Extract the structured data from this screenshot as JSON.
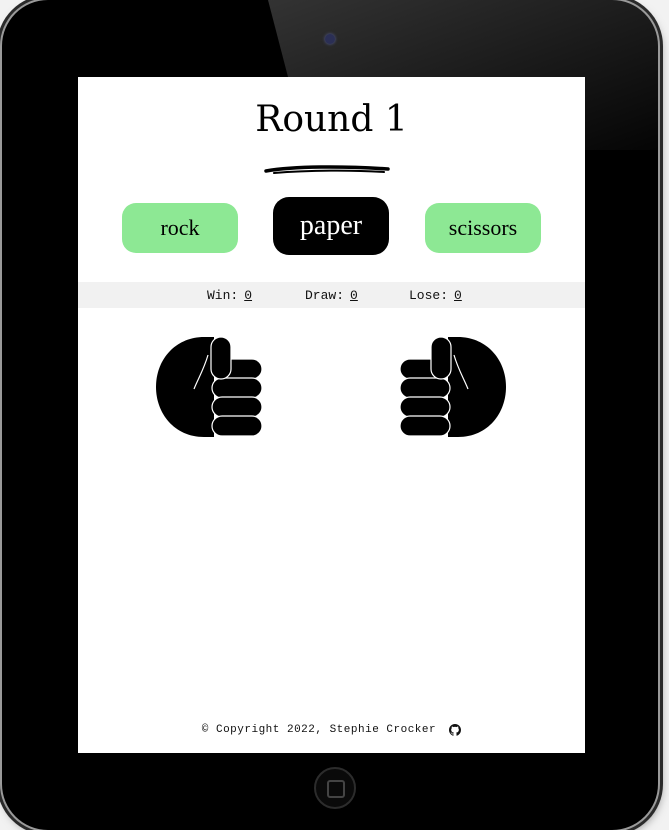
{
  "game": {
    "round_title": "Round 1"
  },
  "choices": {
    "rock": "rock",
    "paper": "paper",
    "scissors": "scissors"
  },
  "score": {
    "win_label": "Win:",
    "win_value": "0",
    "draw_label": "Draw:",
    "draw_value": "0",
    "lose_label": "Lose:",
    "lose_value": "0"
  },
  "hands": {
    "player": "rock-hand-icon",
    "computer": "rock-hand-icon"
  },
  "footer": {
    "copyright": "© Copyright 2022, Stephie Crocker",
    "github_icon": "github-icon"
  },
  "colors": {
    "button_green": "#8de894",
    "button_selected": "#000000",
    "score_bar": "#f1f1f1"
  }
}
